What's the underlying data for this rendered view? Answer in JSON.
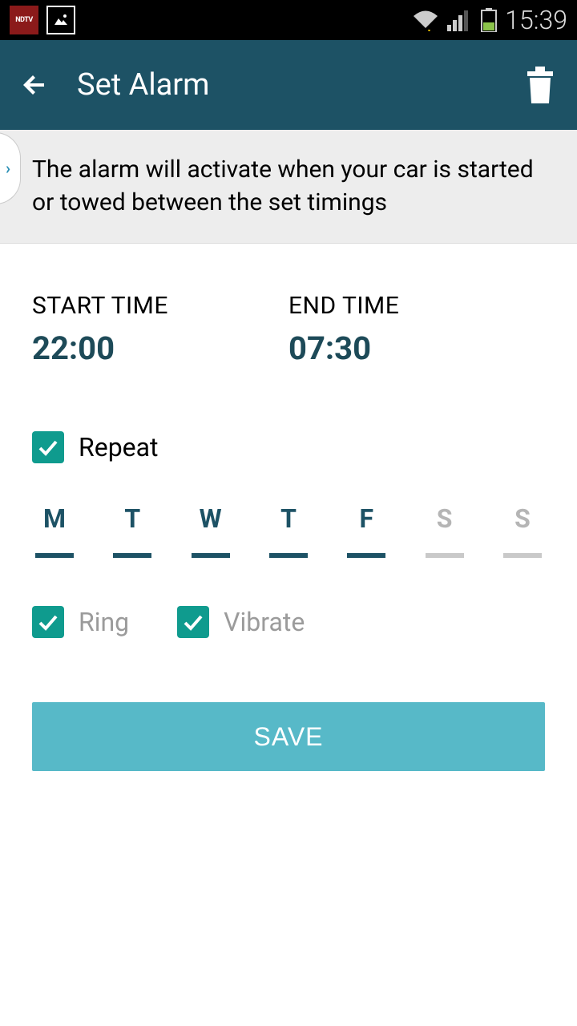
{
  "status": {
    "time": "15:39",
    "ndtv": "NDTV"
  },
  "header": {
    "title": "Set Alarm"
  },
  "banner": {
    "text": "The alarm will activate when your car is started or towed between the set timings"
  },
  "times": {
    "start_label": "START TIME",
    "start_value": "22:00",
    "end_label": "END TIME",
    "end_value": "07:30"
  },
  "repeat": {
    "label": "Repeat",
    "checked": true
  },
  "days": [
    {
      "letter": "M",
      "active": true
    },
    {
      "letter": "T",
      "active": true
    },
    {
      "letter": "W",
      "active": true
    },
    {
      "letter": "T",
      "active": true
    },
    {
      "letter": "F",
      "active": true
    },
    {
      "letter": "S",
      "active": false
    },
    {
      "letter": "S",
      "active": false
    }
  ],
  "options": {
    "ring_label": "Ring",
    "ring_checked": true,
    "vibrate_label": "Vibrate",
    "vibrate_checked": true
  },
  "actions": {
    "save": "SAVE"
  }
}
